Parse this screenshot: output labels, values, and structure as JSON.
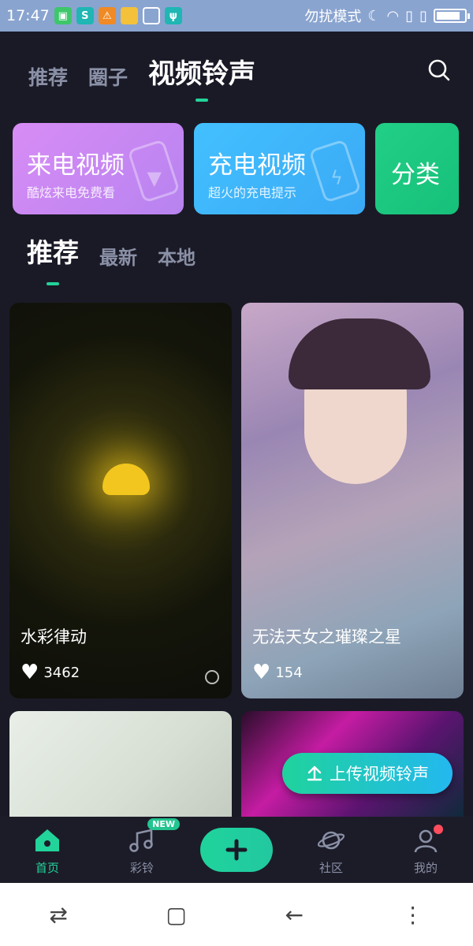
{
  "status_bar": {
    "time": "17:47",
    "right_text": "勿扰模式",
    "battery_level": 0.85,
    "app_icons": [
      "app-icon-green",
      "app-icon-teal",
      "warning-icon",
      "folder-icon",
      "broom-icon",
      "usb-icon"
    ]
  },
  "header": {
    "tabs": [
      "推荐",
      "圈子",
      "视频铃声"
    ],
    "active_tab_index": 2,
    "search_icon": "search-icon"
  },
  "feature_cards": [
    {
      "title": "来电视频",
      "subtitle": "酷炫来电免费看",
      "color_from": "#d88cf5",
      "color_to": "#b783f0"
    },
    {
      "title": "充电视频",
      "subtitle": "超火的充电提示",
      "color_from": "#43c0ff",
      "color_to": "#3aa9f5"
    },
    {
      "title": "分类",
      "subtitle": "",
      "color_from": "#22cf86",
      "color_to": "#16c07a"
    }
  ],
  "sub_tabs": [
    "推荐",
    "最新",
    "本地"
  ],
  "active_sub_tab_index": 0,
  "videos": [
    {
      "title": "水彩律动",
      "likes": "3462"
    },
    {
      "title": "无法天女之璀璨之星",
      "likes": "154"
    },
    {
      "title": "",
      "likes": ""
    },
    {
      "title": "",
      "likes": ""
    }
  ],
  "upload_button": {
    "label": "上传视频铃声",
    "icon": "upload-arrow-icon"
  },
  "bottom_nav": {
    "items": [
      {
        "label": "首页",
        "icon": "home-icon",
        "active": true
      },
      {
        "label": "彩铃",
        "icon": "music-note-icon",
        "badge": "NEW"
      },
      {
        "label": "",
        "icon": "plus-icon"
      },
      {
        "label": "社区",
        "icon": "planet-icon"
      },
      {
        "label": "我的",
        "icon": "user-icon"
      }
    ]
  },
  "colors": {
    "accent": "#22d39a",
    "background": "#1a1a26",
    "inactive_text": "#8a90a6"
  }
}
